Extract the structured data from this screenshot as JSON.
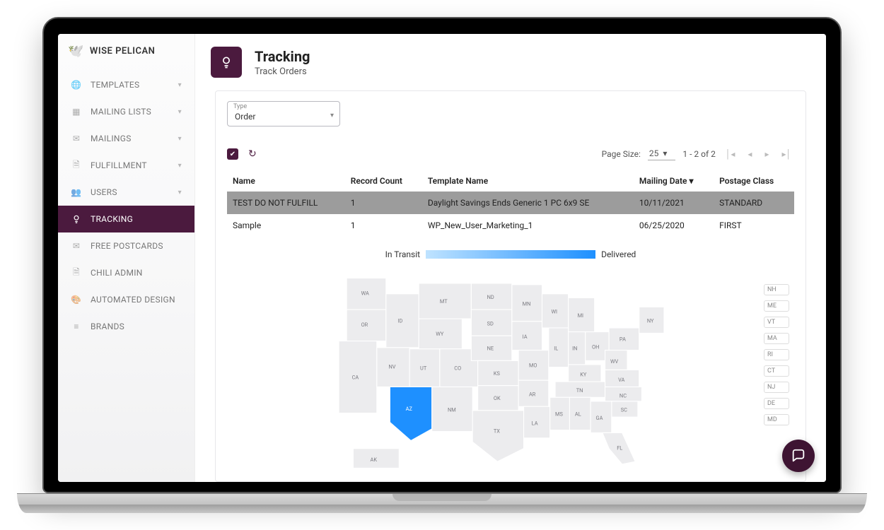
{
  "brand": {
    "name": "WISE PELICAN"
  },
  "sidebar": {
    "items": [
      {
        "label": "TEMPLATES",
        "icon": "globe",
        "expandable": true
      },
      {
        "label": "MAILING LISTS",
        "icon": "grid",
        "expandable": true
      },
      {
        "label": "MAILINGS",
        "icon": "mail",
        "expandable": true
      },
      {
        "label": "FULFILLMENT",
        "icon": "doc",
        "expandable": true
      },
      {
        "label": "USERS",
        "icon": "users",
        "expandable": true
      },
      {
        "label": "TRACKING",
        "icon": "bulb",
        "active": true
      },
      {
        "label": "FREE POSTCARDS",
        "icon": "mail"
      },
      {
        "label": "CHILI ADMIN",
        "icon": "doc"
      },
      {
        "label": "AUTOMATED DESIGN",
        "icon": "palette"
      },
      {
        "label": "BRANDS",
        "icon": "list"
      }
    ]
  },
  "header": {
    "title": "Tracking",
    "subtitle": "Track Orders"
  },
  "filter": {
    "type_label": "Type",
    "type_value": "Order"
  },
  "pagination": {
    "page_size_label": "Page Size:",
    "page_size_value": "25",
    "range": "1 - 2 of 2"
  },
  "table": {
    "cols": [
      "Name",
      "Record Count",
      "Template Name",
      "Mailing Date",
      "Postage Class"
    ],
    "sort_col": "Mailing Date",
    "rows": [
      {
        "name": "TEST DO NOT FULFILL",
        "count": "1",
        "template": "Daylight Savings Ends Generic 1 PC 6x9 SE",
        "date": "10/11/2021",
        "postage": "STANDARD",
        "selected": true
      },
      {
        "name": "Sample",
        "count": "1",
        "template": "WP_New_User_Marketing_1",
        "date": "06/25/2020",
        "postage": "FIRST"
      }
    ]
  },
  "legend": {
    "left": "In Transit",
    "right": "Delivered"
  },
  "map": {
    "highlight": "AZ",
    "state_labels": [
      "WA",
      "OR",
      "CA",
      "ID",
      "NV",
      "UT",
      "AZ",
      "MT",
      "WY",
      "CO",
      "NM",
      "ND",
      "SD",
      "NE",
      "KS",
      "OK",
      "TX",
      "MN",
      "IA",
      "MO",
      "AR",
      "LA",
      "WI",
      "MI",
      "IL",
      "IN",
      "OH",
      "KY",
      "TN",
      "MS",
      "AL",
      "PA",
      "WV",
      "VA",
      "NC",
      "SC",
      "GA",
      "FL",
      "NY",
      "AK"
    ],
    "east_boxes": [
      "NH",
      "ME",
      "VT",
      "MA",
      "RI",
      "CT",
      "NJ",
      "DE",
      "MD"
    ]
  },
  "colors": {
    "accent": "#4b1a3e",
    "highlight": "#1e90ff"
  }
}
